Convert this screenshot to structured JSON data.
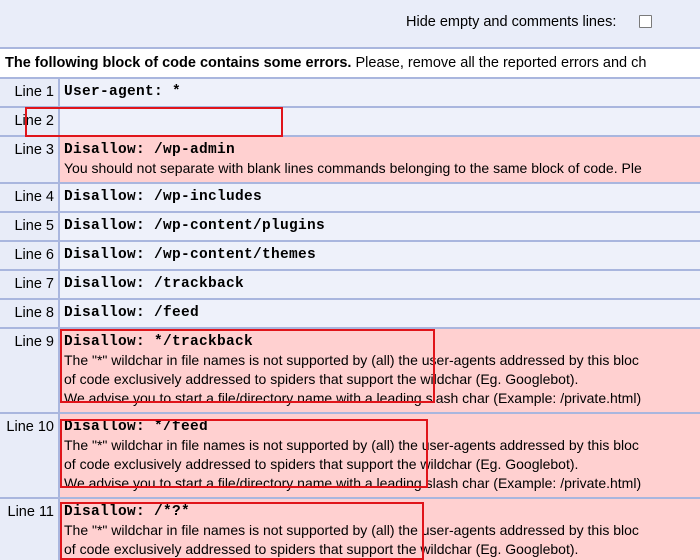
{
  "header": {
    "hide_label": "Hide empty and comments lines:",
    "hide_checked": false
  },
  "notice": {
    "bold": "The following block of code contains some errors.",
    "text": " Please, remove all the reported errors and ch"
  },
  "rows": [
    {
      "num": "Line 1",
      "code": "User-agent: *"
    },
    {
      "num": "Line 2",
      "code": ""
    },
    {
      "num": "Line 3",
      "code": "Disallow: /wp-admin",
      "msg": [
        "You should not separate with blank lines commands belonging to the same block of code. Ple"
      ]
    },
    {
      "num": "Line 4",
      "code": "Disallow: /wp-includes"
    },
    {
      "num": "Line 5",
      "code": "Disallow: /wp-content/plugins"
    },
    {
      "num": "Line 6",
      "code": "Disallow: /wp-content/themes"
    },
    {
      "num": "Line 7",
      "code": "Disallow: /trackback"
    },
    {
      "num": "Line 8",
      "code": "Disallow: /feed"
    },
    {
      "num": "Line 9",
      "code": "Disallow: */trackback",
      "msg": [
        "The \"*\" wildchar in file names is not supported by (all) the user-agents addressed by this bloc",
        "of code exclusively addressed to spiders that support the wildchar (Eg. Googlebot).",
        "We advise you to start a file/directory name with a leading slash char (Example: /private.html)"
      ]
    },
    {
      "num": "Line 10",
      "code": "Disallow: */feed",
      "msg": [
        "The \"*\" wildchar in file names is not supported by (all) the user-agents addressed by this bloc",
        "of code exclusively addressed to spiders that support the wildchar (Eg. Googlebot).",
        "We advise you to start a file/directory name with a leading slash char (Example: /private.html)"
      ]
    },
    {
      "num": "Line 11",
      "code": "Disallow: /*?*",
      "msg": [
        "The \"*\" wildchar in file names is not supported by (all) the user-agents addressed by this bloc",
        "of code exclusively addressed to spiders that support the wildchar (Eg. Googlebot)."
      ]
    }
  ]
}
